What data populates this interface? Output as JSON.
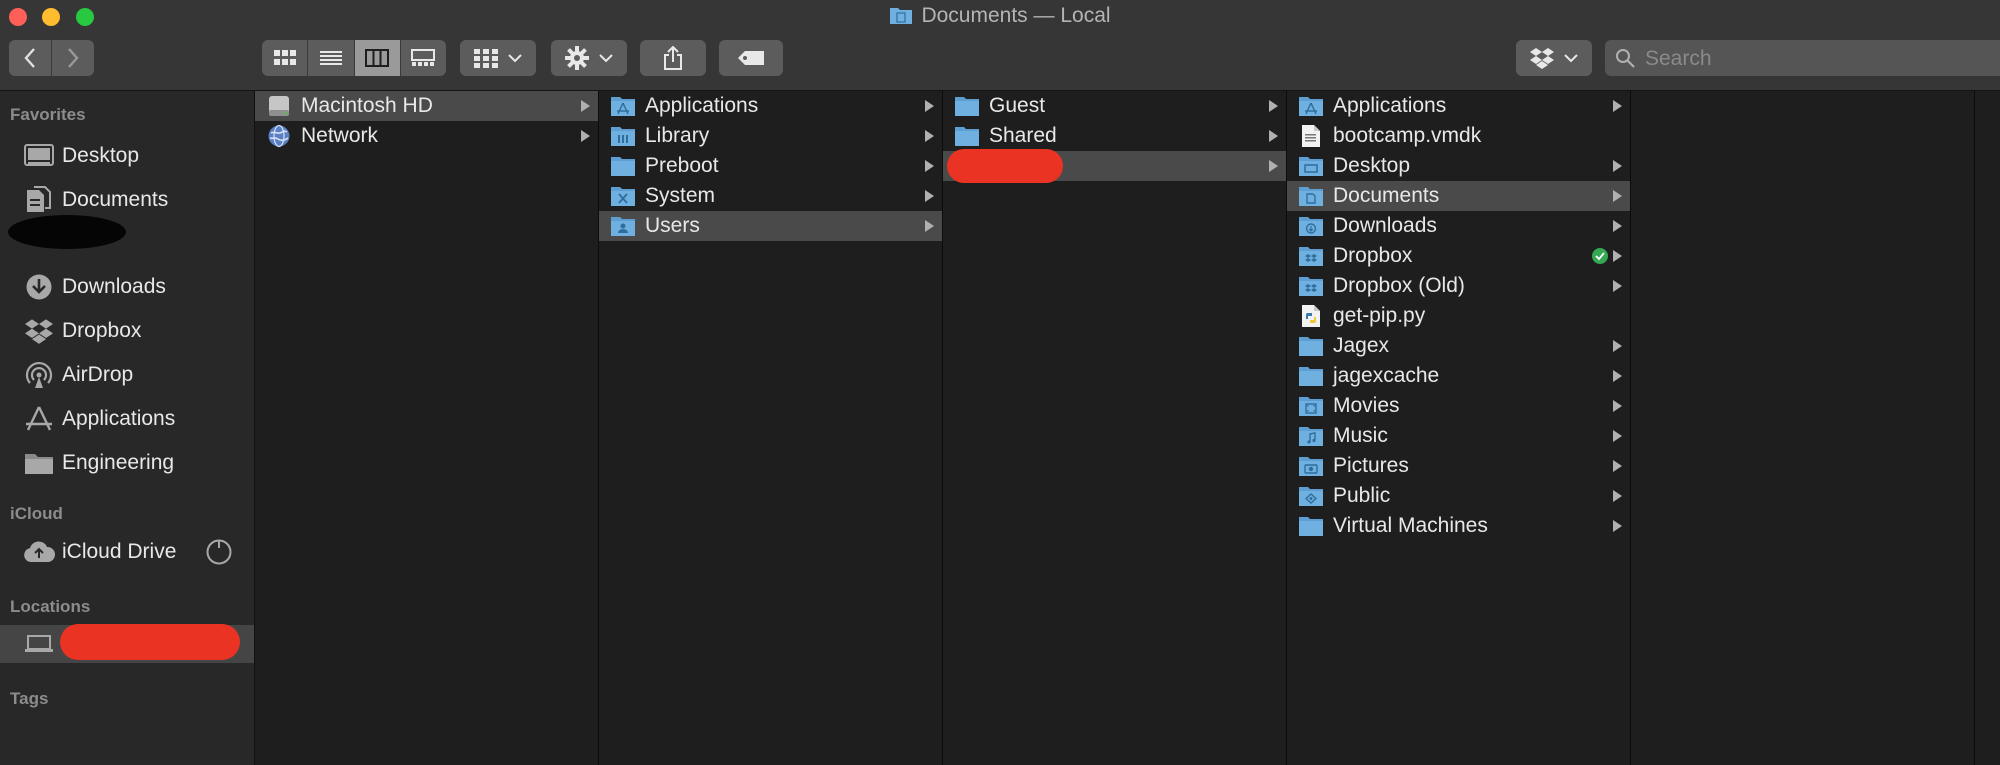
{
  "window": {
    "title": "Documents — Local"
  },
  "search": {
    "placeholder": "Search"
  },
  "sidebar": {
    "favorites_header": "Favorites",
    "favorites": [
      {
        "label": "Desktop",
        "icon": "desktop-icon"
      },
      {
        "label": "Documents",
        "icon": "documents-icon"
      },
      {
        "label": "Downloads",
        "icon": "downloads-icon"
      },
      {
        "label": "Dropbox",
        "icon": "dropbox-icon"
      },
      {
        "label": "AirDrop",
        "icon": "airdrop-icon"
      },
      {
        "label": "Applications",
        "icon": "applications-icon"
      },
      {
        "label": "Engineering",
        "icon": "folder-icon"
      }
    ],
    "icloud_header": "iCloud",
    "icloud": [
      {
        "label": "iCloud Drive",
        "icon": "icloud-icon"
      }
    ],
    "locations_header": "Locations",
    "tags_header": "Tags"
  },
  "columns": [
    {
      "items": [
        {
          "label": "Macintosh HD",
          "icon": "hard-drive-icon",
          "selected": true,
          "arrow": true
        },
        {
          "label": "Network",
          "icon": "network-globe-icon",
          "selected": false,
          "arrow": true
        }
      ]
    },
    {
      "items": [
        {
          "label": "Applications",
          "icon": "applications-folder-icon",
          "selected": false,
          "arrow": true
        },
        {
          "label": "Library",
          "icon": "library-folder-icon",
          "selected": false,
          "arrow": true
        },
        {
          "label": "Preboot",
          "icon": "folder-icon",
          "selected": false,
          "arrow": true
        },
        {
          "label": "System",
          "icon": "system-folder-icon",
          "selected": false,
          "arrow": true
        },
        {
          "label": "Users",
          "icon": "users-folder-icon",
          "selected": true,
          "arrow": true
        }
      ]
    },
    {
      "items": [
        {
          "label": "Guest",
          "icon": "folder-icon",
          "selected": false,
          "arrow": true
        },
        {
          "label": "Shared",
          "icon": "folder-icon",
          "selected": false,
          "arrow": true
        }
      ]
    },
    {
      "items": [
        {
          "label": "Applications",
          "icon": "applications-folder-icon",
          "arrow": true
        },
        {
          "label": "bootcamp.vmdk",
          "icon": "document-file-icon",
          "arrow": false
        },
        {
          "label": "Desktop",
          "icon": "desktop-folder-icon",
          "arrow": true
        },
        {
          "label": "Documents",
          "icon": "documents-folder-icon",
          "arrow": true,
          "selected": true
        },
        {
          "label": "Downloads",
          "icon": "downloads-folder-icon",
          "arrow": true
        },
        {
          "label": "Dropbox",
          "icon": "dropbox-folder-icon",
          "arrow": true,
          "synced": true
        },
        {
          "label": "Dropbox (Old)",
          "icon": "dropbox-folder-icon",
          "arrow": true
        },
        {
          "label": "get-pip.py",
          "icon": "python-file-icon",
          "arrow": false
        },
        {
          "label": "Jagex",
          "icon": "folder-icon",
          "arrow": true
        },
        {
          "label": "jagexcache",
          "icon": "folder-icon",
          "arrow": true
        },
        {
          "label": "Movies",
          "icon": "movies-folder-icon",
          "arrow": true
        },
        {
          "label": "Music",
          "icon": "music-folder-icon",
          "arrow": true
        },
        {
          "label": "Pictures",
          "icon": "pictures-folder-icon",
          "arrow": true
        },
        {
          "label": "Public",
          "icon": "public-folder-icon",
          "arrow": true
        },
        {
          "label": "Virtual Machines",
          "icon": "folder-icon",
          "arrow": true
        }
      ]
    }
  ],
  "colors": {
    "folder": "#6fb0e0",
    "selection": "#4a4a4a",
    "sync_badge": "#34a853",
    "redaction": "#ea3323"
  }
}
